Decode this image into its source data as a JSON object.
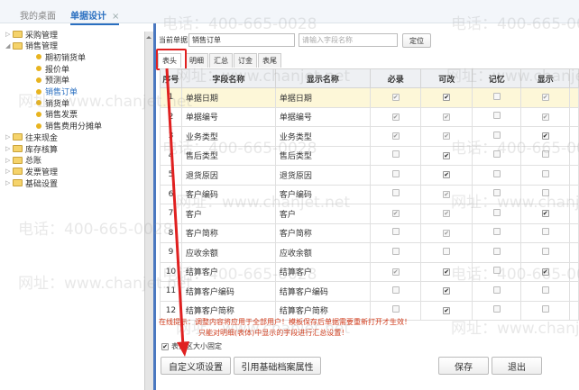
{
  "top_tabs": [
    {
      "label": "我的桌面"
    },
    {
      "label": "单据设计",
      "close": "×"
    }
  ],
  "tree": [
    {
      "label": "采购管理",
      "type": "folder",
      "expanded": false
    },
    {
      "label": "销售管理",
      "type": "folder",
      "expanded": true
    },
    {
      "label": "期初销货单",
      "type": "leaf"
    },
    {
      "label": "报价单",
      "type": "leaf"
    },
    {
      "label": "预测单",
      "type": "leaf"
    },
    {
      "label": "销售订单",
      "type": "leaf",
      "selected": true
    },
    {
      "label": "销货单",
      "type": "leaf"
    },
    {
      "label": "销售发票",
      "type": "leaf"
    },
    {
      "label": "销售费用分摊单",
      "type": "leaf"
    },
    {
      "label": "往来现金",
      "type": "folder",
      "expanded": false
    },
    {
      "label": "库存核算",
      "type": "folder",
      "expanded": false
    },
    {
      "label": "总账",
      "type": "folder",
      "expanded": false
    },
    {
      "label": "发票管理",
      "type": "folder",
      "expanded": false
    },
    {
      "label": "基础设置",
      "type": "folder",
      "expanded": false
    }
  ],
  "main": {
    "current_label": "当前单据",
    "current_value": "销售订单",
    "search_placeholder": "请输入字段名称",
    "locate_button": "定位",
    "subtabs": [
      "表头",
      "明细",
      "汇总",
      "订金",
      "表尾"
    ],
    "columns": [
      "序号",
      "字段名称",
      "显示名称",
      "必录",
      "可改",
      "记忆",
      "显示"
    ],
    "rows": [
      {
        "no": "1",
        "field": "单据日期",
        "display": "单据日期",
        "flags": [
          "checked-disabled",
          "checked",
          "unchecked",
          "checked-disabled"
        ]
      },
      {
        "no": "2",
        "field": "单据编号",
        "display": "单据编号",
        "flags": [
          "checked-disabled",
          "checked-disabled",
          "unchecked",
          "checked-disabled"
        ]
      },
      {
        "no": "3",
        "field": "业务类型",
        "display": "业务类型",
        "flags": [
          "checked-disabled",
          "checked-disabled",
          "unchecked",
          "checked"
        ]
      },
      {
        "no": "4",
        "field": "售后类型",
        "display": "售后类型",
        "flags": [
          "unchecked",
          "checked",
          "unchecked",
          "unchecked"
        ]
      },
      {
        "no": "5",
        "field": "退货原因",
        "display": "退货原因",
        "flags": [
          "unchecked",
          "checked",
          "unchecked",
          "unchecked"
        ]
      },
      {
        "no": "6",
        "field": "客户编码",
        "display": "客户编码",
        "flags": [
          "unchecked",
          "checked-disabled",
          "unchecked",
          "unchecked"
        ]
      },
      {
        "no": "7",
        "field": "客户",
        "display": "客户",
        "flags": [
          "checked-disabled",
          "checked-disabled",
          "unchecked",
          "checked"
        ]
      },
      {
        "no": "8",
        "field": "客户简称",
        "display": "客户简称",
        "flags": [
          "unchecked",
          "checked-disabled",
          "unchecked",
          "unchecked"
        ]
      },
      {
        "no": "9",
        "field": "应收余额",
        "display": "应收余额",
        "flags": [
          "unchecked",
          "unchecked",
          "unchecked",
          "unchecked"
        ]
      },
      {
        "no": "10",
        "field": "结算客户",
        "display": "结算客户",
        "flags": [
          "checked-disabled",
          "checked",
          "unchecked",
          "checked"
        ]
      },
      {
        "no": "11",
        "field": "结算客户编码",
        "display": "结算客户编码",
        "flags": [
          "unchecked",
          "checked",
          "unchecked",
          "unchecked"
        ]
      },
      {
        "no": "12",
        "field": "结算客户简称",
        "display": "结算客户简称",
        "flags": [
          "unchecked",
          "checked",
          "unchecked",
          "unchecked"
        ]
      }
    ],
    "warning_line1": "在线提示：调整内容将应用于全部用户！模板保存后单据需要重新打开才生效！",
    "warning_line2": "只能对明细(表体)中显示的字段进行汇总设置！",
    "fix_size_label": "表体区大小固定",
    "fix_size_checked": true,
    "buttons": {
      "custom": "自定义项设置",
      "ref": "引用基础档案属性",
      "save": "保存",
      "exit": "退出"
    }
  },
  "watermark": {
    "phone": "电话：400-665-0028",
    "site": "网址：www.chanjet.net"
  },
  "colors": {
    "accent": "#2a6fc0",
    "highlight_row": "#fdf7d8",
    "annotation": "#e02020",
    "warning": "#d03a1a"
  }
}
